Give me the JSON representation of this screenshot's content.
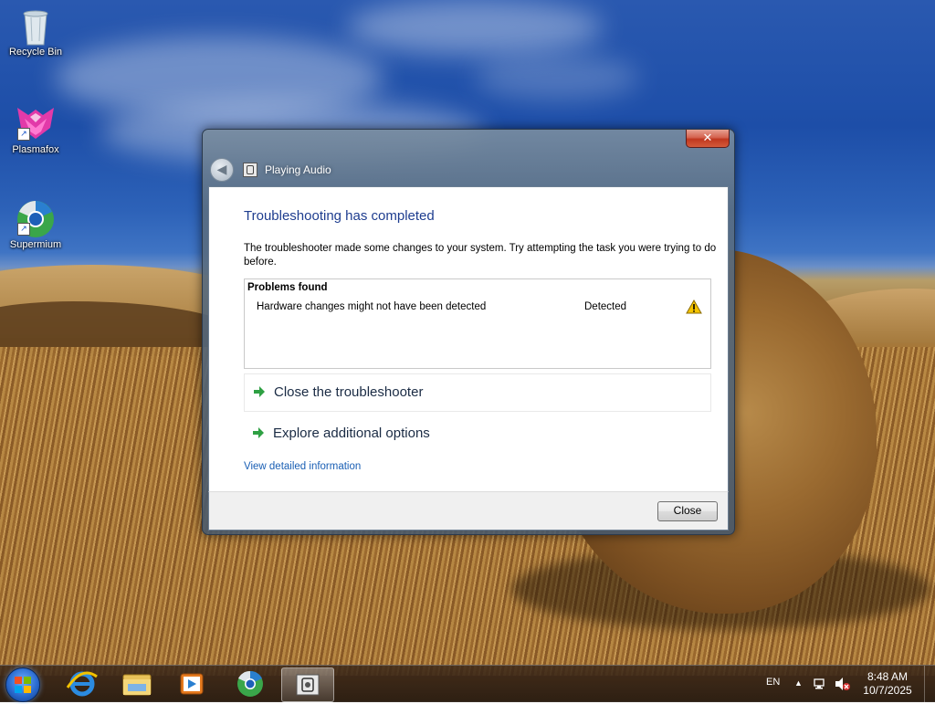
{
  "desktop": {
    "icons": [
      {
        "label": "Recycle Bin",
        "icon": "recycle-bin-icon"
      },
      {
        "label": "Plasmafox",
        "icon": "plasmafox-icon"
      },
      {
        "label": "Supermium",
        "icon": "supermium-icon"
      }
    ]
  },
  "window": {
    "title": "Playing Audio",
    "close_glyph": "✕",
    "back_glyph": "◀",
    "heading": "Troubleshooting has completed",
    "description": "The troubleshooter made some changes to your system. Try attempting the task you were trying to do before.",
    "problems": {
      "header": "Problems found",
      "rows": [
        {
          "name": "Hardware changes might not have been detected",
          "status": "Detected",
          "icon": "warning-icon"
        }
      ]
    },
    "options": [
      {
        "label": "Close the troubleshooter",
        "icon": "green-arrow-icon"
      },
      {
        "label": "Explore additional options",
        "icon": "green-arrow-icon"
      }
    ],
    "detail_link": "View detailed information",
    "footer": {
      "close_label": "Close"
    }
  },
  "taskbar": {
    "apps": [
      "ie-icon",
      "explorer-icon",
      "media-player-icon",
      "supermium-icon",
      "troubleshooter-icon"
    ],
    "tray": {
      "language": "EN",
      "time": "8:48 AM",
      "date": "10/7/2025"
    }
  },
  "colors": {
    "heading": "#1e3d8f",
    "link": "#1a5fb4",
    "arrow": "#2ea043",
    "warning": "#f5c400"
  }
}
